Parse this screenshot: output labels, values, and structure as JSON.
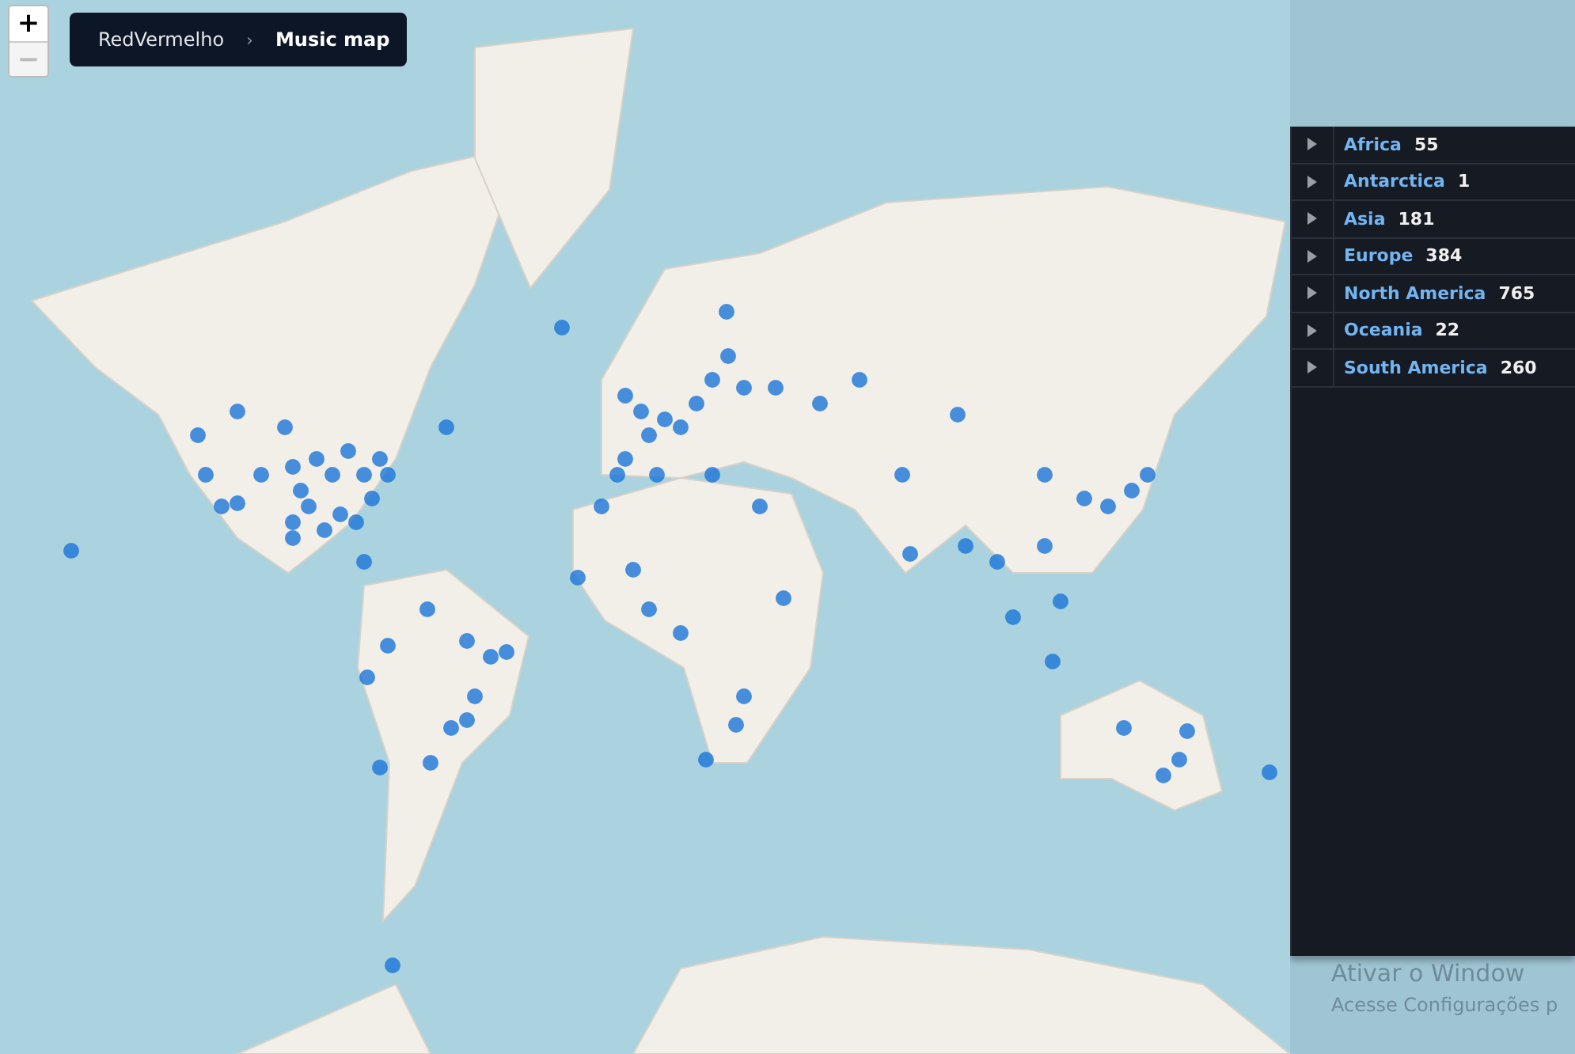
{
  "zoom_control": {
    "buttons": [
      {
        "label": "+",
        "disabled": false
      },
      {
        "label": "−",
        "disabled": true
      }
    ]
  },
  "breadcrumb": {
    "items": [
      {
        "label": "RedVermelho",
        "current": false
      },
      {
        "label": "Music map",
        "current": true
      }
    ],
    "separator": "›"
  },
  "regions_panel": {
    "items": [
      {
        "name": "Africa",
        "count": "55",
        "expanded": false
      },
      {
        "name": "Antarctica",
        "count": "1",
        "expanded": false
      },
      {
        "name": "Asia",
        "count": "181",
        "expanded": false
      },
      {
        "name": "Europe",
        "count": "384",
        "expanded": false
      },
      {
        "name": "North America",
        "count": "765",
        "expanded": false
      },
      {
        "name": "Oceania",
        "count": "22",
        "expanded": false
      },
      {
        "name": "South America",
        "count": "260",
        "expanded": false
      }
    ]
  },
  "activation_notice": {
    "title": "Ativar o Window",
    "text": "Acesse Configurações p"
  }
}
